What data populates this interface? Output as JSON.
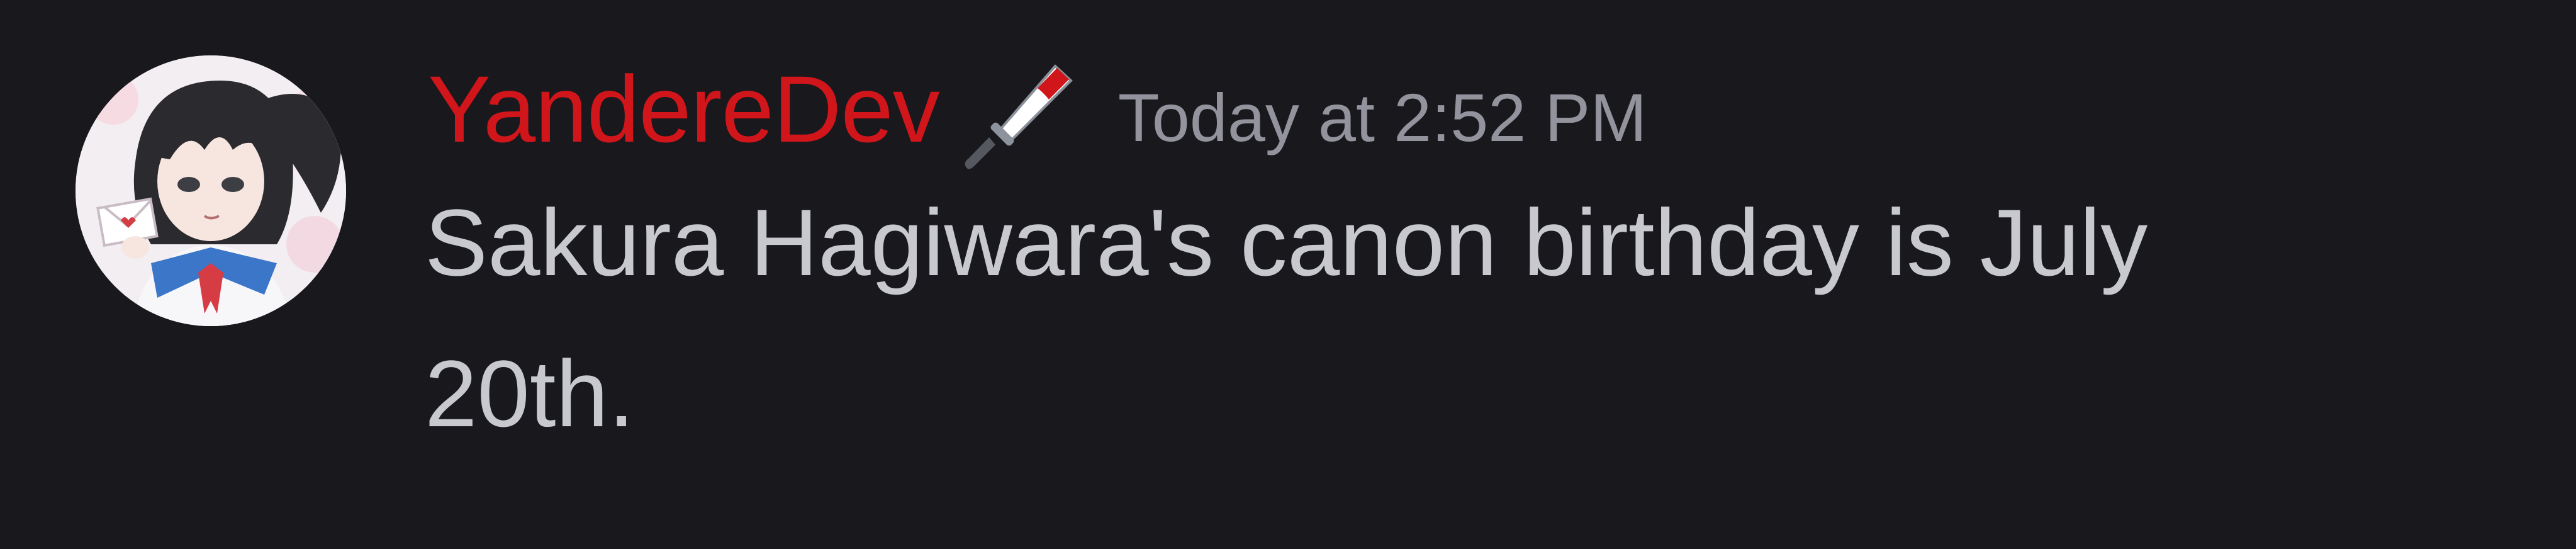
{
  "message": {
    "author": "YandereDev",
    "author_color": "#d0161b",
    "role_icon": "knife-icon",
    "timestamp": "Today at 2:52 PM",
    "text": "Sakura Hagiwara's canon birthday is July 20th."
  },
  "avatar": {
    "icon": "anime-girl-avatar"
  }
}
